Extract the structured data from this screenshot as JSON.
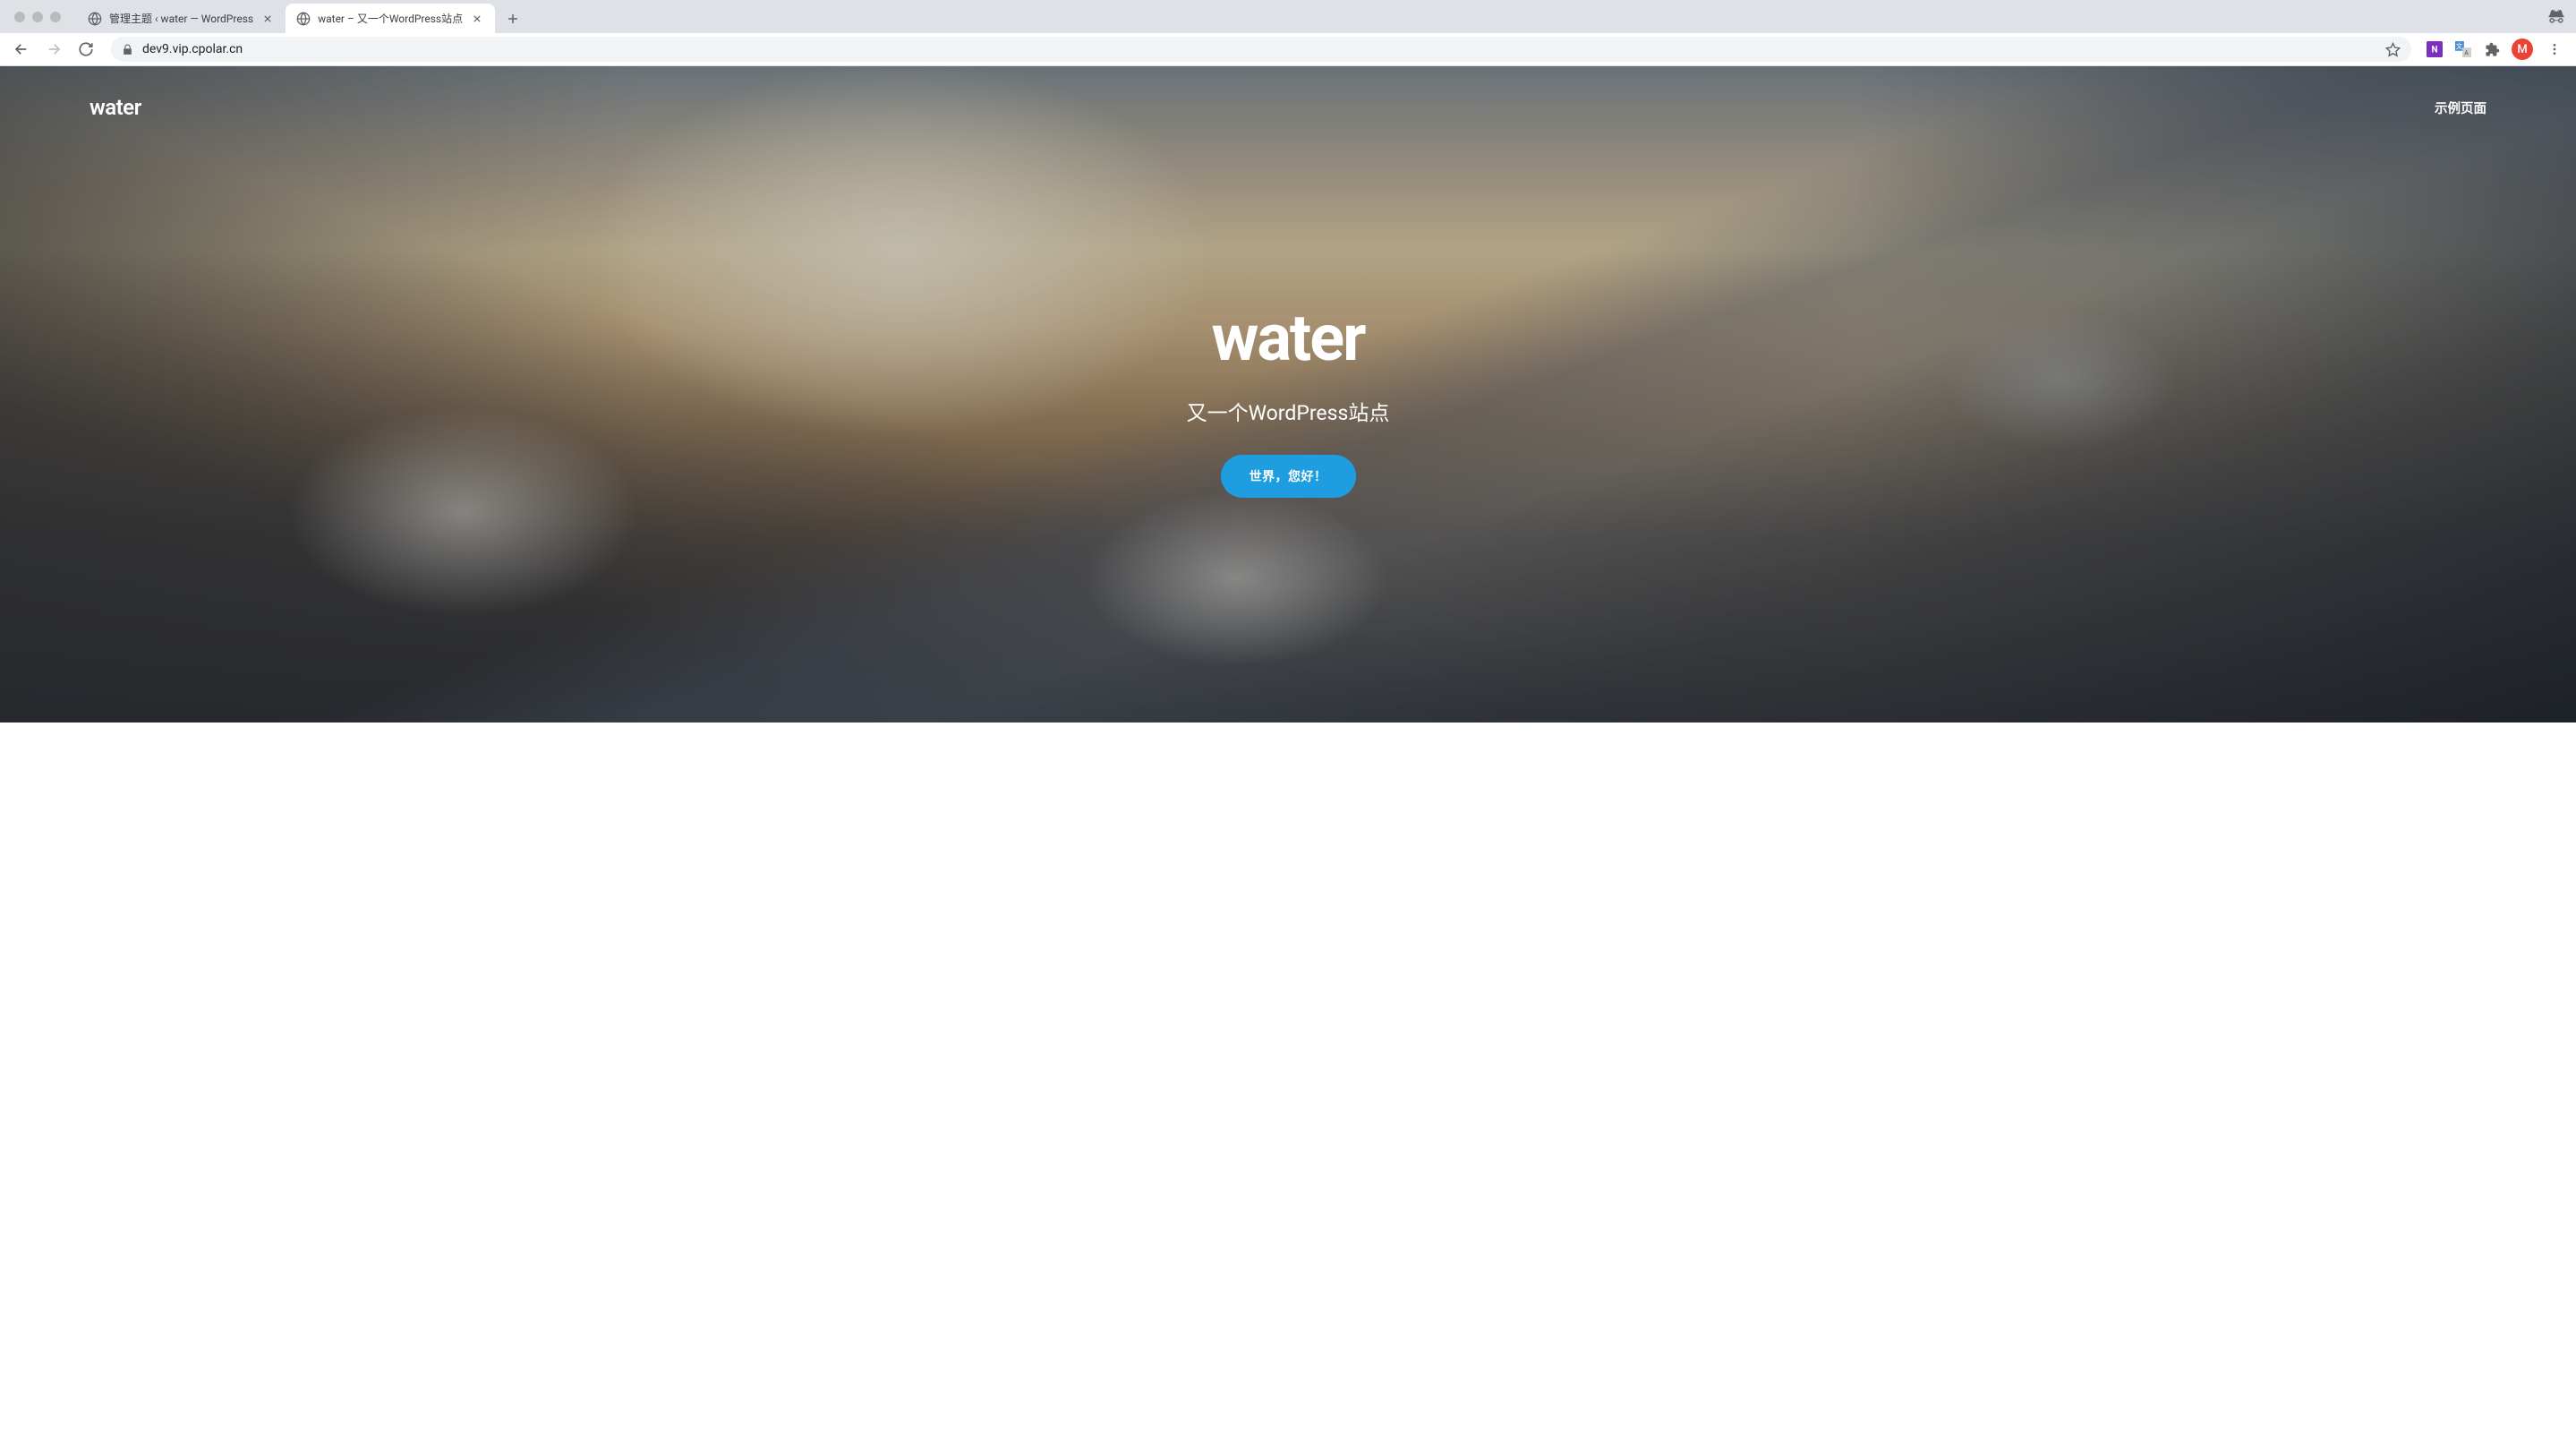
{
  "browser": {
    "tabs": [
      {
        "title": "管理主题 ‹ water — WordPress",
        "active": false
      },
      {
        "title": "water – 又一个WordPress站点",
        "active": true
      }
    ],
    "url": "dev9.vip.cpolar.cn",
    "profile_initial": "M"
  },
  "header": {
    "logo": "water",
    "nav": [
      {
        "label": "示例页面"
      }
    ]
  },
  "hero": {
    "title": "water",
    "tagline": "又一个WordPress站点",
    "button_label": "世界，您好！"
  }
}
